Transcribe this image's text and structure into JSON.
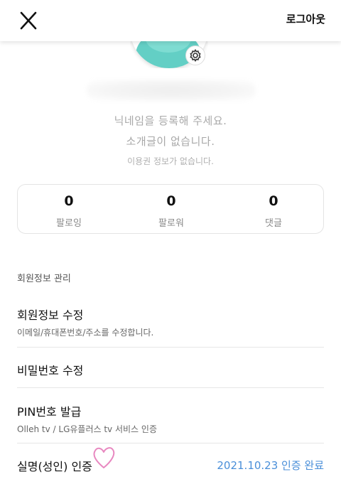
{
  "header": {
    "close_icon": "close-icon",
    "logout_label": "로그아웃"
  },
  "profile": {
    "settings_icon": "gear-icon",
    "nickname_prompt": "닉네임을 등록해 주세요.",
    "bio": "소개글이 없습니다.",
    "pass_info": "이용권 정보가 없습니다.",
    "avatar_color": "#63cfc5"
  },
  "stats": [
    {
      "value": "0",
      "label": "팔로잉"
    },
    {
      "value": "0",
      "label": "팔로워"
    },
    {
      "value": "0",
      "label": "댓글"
    }
  ],
  "account": {
    "section_title": "회원정보 관리",
    "items": [
      {
        "title": "회원정보 수정",
        "subtitle": "이메일/휴대폰번호/주소를 수정합니다."
      },
      {
        "title": "비밀번호 수정"
      },
      {
        "title": "PIN번호 발급",
        "subtitle": "Olleh tv / LG유플러스 tv 서비스 인증"
      },
      {
        "title": "실명(성인) 인증",
        "status": "2021.10.23 인증 완료"
      }
    ]
  },
  "colors": {
    "accent": "#4a8fd9",
    "heart": "#e888c0"
  }
}
